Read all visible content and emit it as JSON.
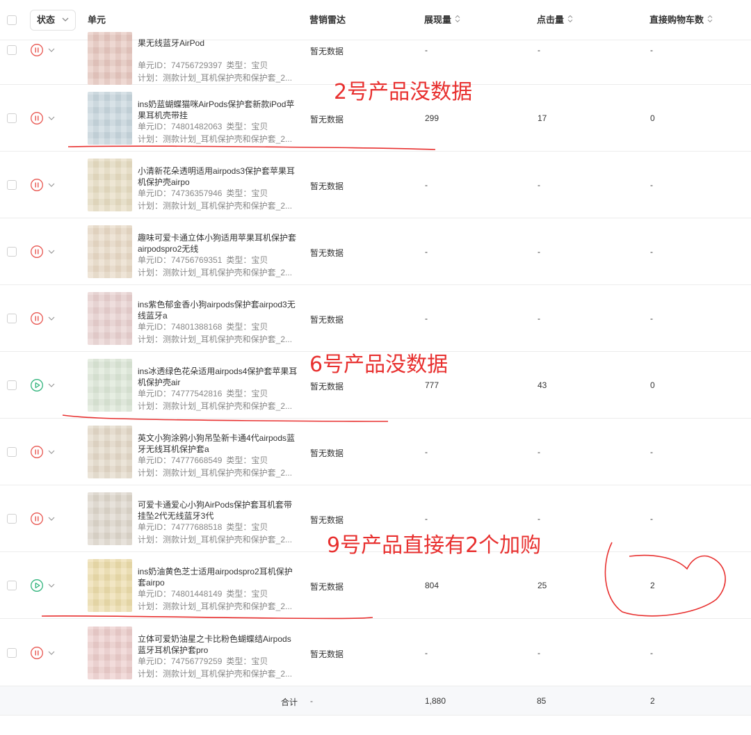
{
  "header": {
    "status_label": "状态",
    "unit_label": "单元",
    "radar_label": "营销雷达",
    "impressions_label": "展现量",
    "clicks_label": "点击量",
    "cart_label": "直接购物车数"
  },
  "rows": [
    {
      "state": "paused",
      "title": "果无线蓝牙AirPod",
      "id": "单元ID：74756729397",
      "type": "类型：宝贝",
      "plan": "计划：测款计划_耳机保护壳和保护套_2...",
      "radar": "暂无数据",
      "impressions": "-",
      "clicks": "-",
      "cart": "-",
      "thumb_color": "#e6c7bf"
    },
    {
      "state": "paused",
      "title": "ins奶蓝蝴蝶猫咪AirPods保护套新款iPod苹果耳机壳带挂",
      "id": "单元ID：74801482063",
      "type": "类型：宝贝",
      "plan": "计划：测款计划_耳机保护壳和保护套_2...",
      "radar": "暂无数据",
      "impressions": "299",
      "clicks": "17",
      "cart": "0",
      "thumb_color": "#c8d6dd"
    },
    {
      "state": "paused",
      "title": "小清新花朵透明适用airpods3保护套苹果耳机保护壳airpo",
      "id": "单元ID：74736357946",
      "type": "类型：宝贝",
      "plan": "计划：测款计划_耳机保护壳和保护套_2...",
      "radar": "暂无数据",
      "impressions": "-",
      "clicks": "-",
      "cart": "-",
      "thumb_color": "#e6dcc2"
    },
    {
      "state": "paused",
      "title": "趣味可爱卡通立体小狗适用苹果耳机保护套airpodspro2无线",
      "id": "单元ID：74756769351",
      "type": "类型：宝贝",
      "plan": "计划：测款计划_耳机保护壳和保护套_2...",
      "radar": "暂无数据",
      "impressions": "-",
      "clicks": "-",
      "cart": "-",
      "thumb_color": "#e8d9c6"
    },
    {
      "state": "paused",
      "title": "ins紫色郁金香小狗airpods保护套airpod3无线蓝牙a",
      "id": "单元ID：74801388168",
      "type": "类型：宝贝",
      "plan": "计划：测款计划_耳机保护壳和保护套_2...",
      "radar": "暂无数据",
      "impressions": "-",
      "clicks": "-",
      "cart": "-",
      "thumb_color": "#e8d0cf"
    },
    {
      "state": "running",
      "title": "ins冰透绿色花朵适用airpods4保护套苹果耳机保护壳air",
      "id": "单元ID：74777542816",
      "type": "类型：宝贝",
      "plan": "计划：测款计划_耳机保护壳和保护套_2...",
      "radar": "暂无数据",
      "impressions": "777",
      "clicks": "43",
      "cart": "0",
      "thumb_color": "#dbe6d6"
    },
    {
      "state": "paused",
      "title": "英文小狗涂鸦小狗吊坠新卡通4代airpods蓝牙无线耳机保护套a",
      "id": "单元ID：74777668549",
      "type": "类型：宝贝",
      "plan": "计划：测款计划_耳机保护壳和保护套_2...",
      "radar": "暂无数据",
      "impressions": "-",
      "clicks": "-",
      "cart": "-",
      "thumb_color": "#e3d8c8"
    },
    {
      "state": "paused",
      "title": "可爱卡通爱心小狗AirPods保护套耳机套带挂坠2代无线蓝牙3代",
      "id": "单元ID：74777688518",
      "type": "类型：宝贝",
      "plan": "计划：测款计划_耳机保护壳和保护套_2...",
      "radar": "暂无数据",
      "impressions": "-",
      "clicks": "-",
      "cart": "-",
      "thumb_color": "#ddd6cb"
    },
    {
      "state": "running",
      "title": "ins奶油黄色芝士适用airpodspro2耳机保护套airpo",
      "id": "单元ID：74801448149",
      "type": "类型：宝贝",
      "plan": "计划：测款计划_耳机保护壳和保护套_2...",
      "radar": "暂无数据",
      "impressions": "804",
      "clicks": "25",
      "cart": "2",
      "thumb_color": "#ecdcaa"
    },
    {
      "state": "paused",
      "title": "立体可爱奶油星之卡比粉色蝴蝶结Airpods蓝牙耳机保护套pro",
      "id": "单元ID：74756779259",
      "type": "类型：宝贝",
      "plan": "计划：测款计划_耳机保护壳和保护套_2...",
      "radar": "暂无数据",
      "impressions": "-",
      "clicks": "-",
      "cart": "-",
      "thumb_color": "#eccdcb"
    }
  ],
  "total": {
    "label": "合计",
    "radar": "-",
    "impressions": "1,880",
    "clicks": "85",
    "cart": "2"
  },
  "annotations": {
    "note_2": "2号产品没数据",
    "note_6": "6号产品没数据",
    "note_9": "9号产品直接有2个加购"
  },
  "colors": {
    "paused": "#e8554f",
    "running": "#2fb37b",
    "annotation": "#e8302f"
  }
}
